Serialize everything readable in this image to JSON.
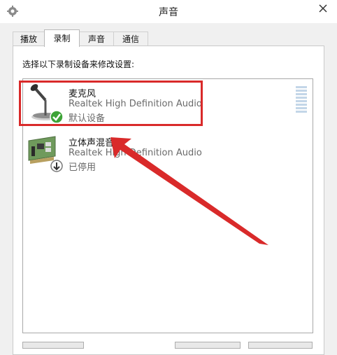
{
  "window": {
    "title": "声音",
    "app_icon": "speaker-settings-icon",
    "close_icon": "close-icon"
  },
  "tabs": [
    {
      "label": "播放",
      "active": false
    },
    {
      "label": "录制",
      "active": true
    },
    {
      "label": "声音",
      "active": false
    },
    {
      "label": "通信",
      "active": false
    }
  ],
  "recording": {
    "instruction": "选择以下录制设备来修改设置:",
    "devices": [
      {
        "name": "麦克风",
        "driver": "Realtek High Definition Audio",
        "status": "默认设备",
        "icon": "microphone-icon",
        "badge": "default-check-icon"
      },
      {
        "name": "立体声混音",
        "driver": "Realtek High Definition Audio",
        "status": "已停用",
        "icon": "sound-card-icon",
        "badge": "disabled-arrow-icon"
      }
    ]
  },
  "annotations": {
    "color": "#d92a2a"
  }
}
